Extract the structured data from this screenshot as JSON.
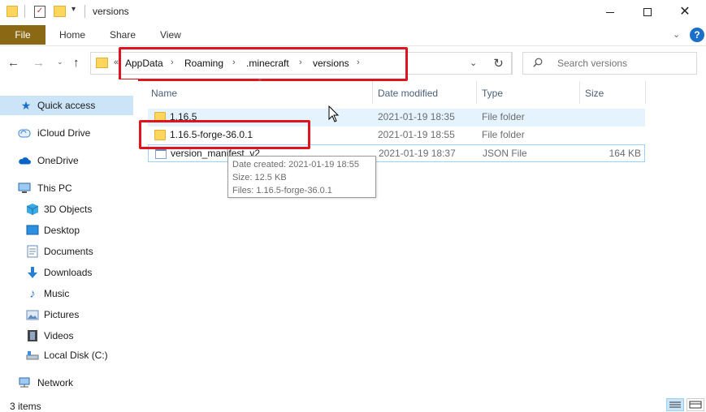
{
  "window": {
    "title": "versions",
    "minimize": "—",
    "maximize": "☐",
    "close": "✕"
  },
  "ribbon": {
    "tabs": [
      "File",
      "Home",
      "Share",
      "View"
    ],
    "help": "?",
    "collapse_icon": "chevron-down-icon"
  },
  "address": {
    "crumbs": [
      "AppData",
      "Roaming",
      ".minecraft",
      "versions"
    ],
    "overflow": "«",
    "separator": "›",
    "refresh": "↻"
  },
  "search": {
    "placeholder": "Search versions"
  },
  "navigation": {
    "items": [
      {
        "label": "Quick access",
        "icon": "star-icon",
        "selected": true
      },
      {
        "label": "iCloud Drive",
        "icon": "icloud-icon"
      },
      {
        "label": "OneDrive",
        "icon": "onedrive-cloud-icon"
      },
      {
        "label": "This PC",
        "icon": "computer-icon"
      },
      {
        "label": "3D Objects",
        "icon": "cube-3d-icon"
      },
      {
        "label": "Desktop",
        "icon": "desktop-icon"
      },
      {
        "label": "Documents",
        "icon": "documents-icon"
      },
      {
        "label": "Downloads",
        "icon": "download-arrow-icon"
      },
      {
        "label": "Music",
        "icon": "music-note-icon"
      },
      {
        "label": "Pictures",
        "icon": "pictures-icon"
      },
      {
        "label": "Videos",
        "icon": "film-icon"
      },
      {
        "label": "Local Disk (C:)",
        "icon": "drive-icon"
      },
      {
        "label": "Network",
        "icon": "network-icon"
      }
    ]
  },
  "file_list": {
    "columns": [
      "Name",
      "Date modified",
      "Type",
      "Size"
    ],
    "rows": [
      {
        "name": "1.16.5",
        "date": "2021-01-19 18:35",
        "type": "File folder",
        "size": "",
        "icon": "folder-icon"
      },
      {
        "name": "1.16.5-forge-36.0.1",
        "date": "2021-01-19 18:55",
        "type": "File folder",
        "size": "",
        "icon": "folder-icon"
      },
      {
        "name": "version_manifest_v2",
        "date": "2021-01-19 18:37",
        "type": "JSON File",
        "size": "164 KB",
        "icon": "json-file-icon"
      }
    ]
  },
  "tooltip": {
    "lines": [
      "Date created: 2021-01-19 18:55",
      "Size: 12.5 KB",
      "Files: 1.16.5-forge-36.0.1"
    ]
  },
  "status": {
    "item_count": "3 items"
  },
  "colors": {
    "highlight_red": "#e0141e",
    "file_tab": "#8b6914",
    "selected_bg": "#cce4f7",
    "hover_bg": "#e5f3ff",
    "folder_yellow": "#ffd65c"
  }
}
